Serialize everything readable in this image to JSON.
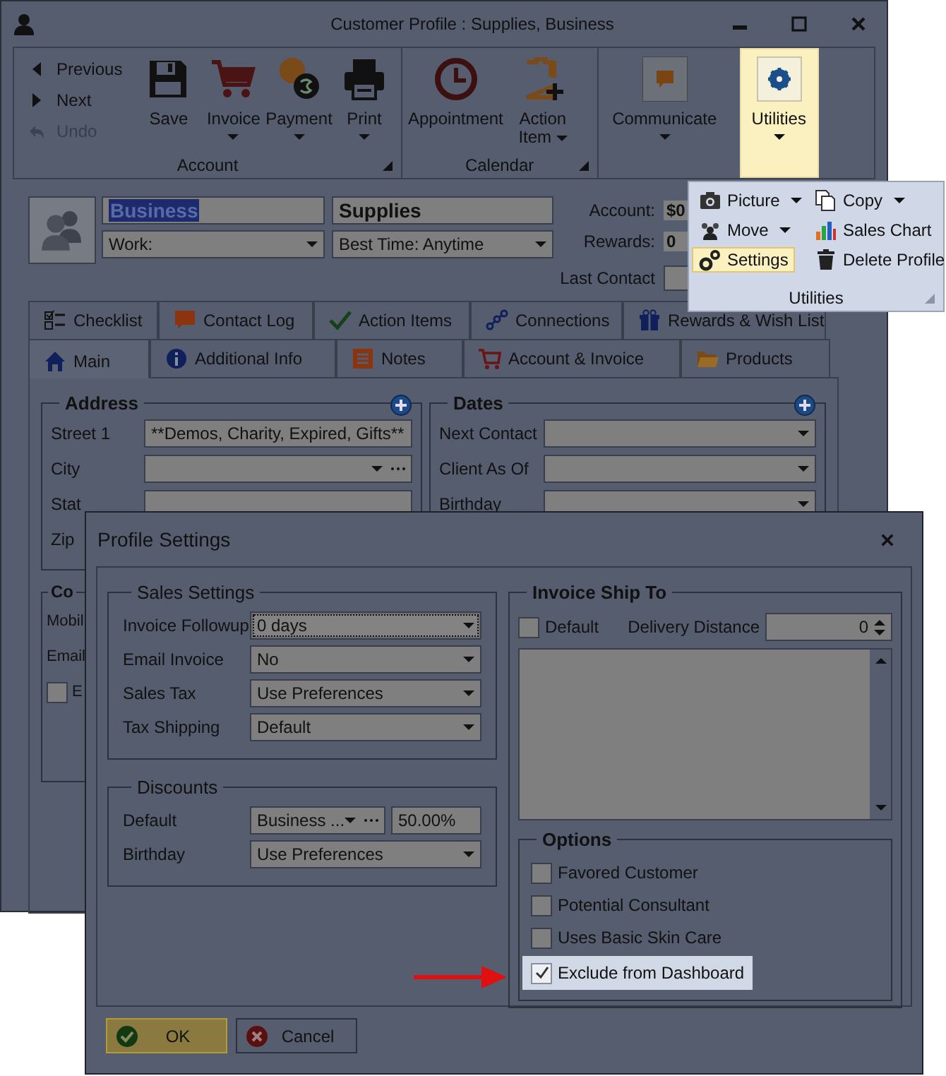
{
  "window": {
    "title": "Customer Profile :  Supplies, Business"
  },
  "ribbon": {
    "nav": [
      {
        "label": "Previous",
        "kind": "prev",
        "disabled": false
      },
      {
        "label": "Next",
        "kind": "next",
        "disabled": false
      },
      {
        "label": "Undo",
        "kind": "undo",
        "disabled": true
      }
    ],
    "groups": [
      {
        "label": "Account",
        "buttons": [
          {
            "label": "Save",
            "kind": "save",
            "dropdown": false,
            "open": false
          },
          {
            "label": "Invoice",
            "kind": "invoice",
            "dropdown": true,
            "open": false
          },
          {
            "label": "Payment",
            "kind": "payment",
            "dropdown": true,
            "open": false
          },
          {
            "label": "Print",
            "kind": "print",
            "dropdown": true,
            "open": false
          }
        ]
      },
      {
        "label": "Calendar",
        "buttons": [
          {
            "label": "Appointment",
            "kind": "appointment",
            "dropdown": false,
            "open": false
          },
          {
            "label": "Action Item",
            "kind": "action",
            "dropdown": true,
            "open": false
          }
        ]
      },
      {
        "buttons": [
          {
            "label": "Communicate",
            "kind": "communicate",
            "dropdown": true,
            "open": false
          },
          {
            "label": "Utilities",
            "kind": "utilities",
            "dropdown": true,
            "open": true
          }
        ]
      }
    ]
  },
  "profile": {
    "first_name": "Business",
    "last_name": "Supplies",
    "phone_type": "Work:",
    "best_time": "Best Time: Anytime",
    "account_label": "Account:",
    "account_value": "$0",
    "rewards_label": "Rewards:",
    "rewards_value": "0",
    "last_contact_label": "Last Contact"
  },
  "utilities_menu": {
    "items": [
      {
        "label": "Picture",
        "kind": "picture",
        "dropdown": true,
        "selected": false
      },
      {
        "label": "Copy",
        "kind": "copy",
        "dropdown": true,
        "selected": false
      },
      {
        "label": "Move",
        "kind": "move",
        "dropdown": true,
        "selected": false
      },
      {
        "label": "Sales Chart",
        "kind": "chart",
        "dropdown": false,
        "selected": false
      },
      {
        "label": "Settings",
        "kind": "settings",
        "dropdown": false,
        "selected": true
      },
      {
        "label": "Delete Profile",
        "kind": "delete",
        "dropdown": false,
        "selected": false
      }
    ],
    "footer": "Utilities"
  },
  "tabs": {
    "row_1": [
      {
        "label": "Checklist",
        "kind": "checklist",
        "selected": false
      },
      {
        "label": "Contact Log",
        "kind": "log",
        "selected": false
      },
      {
        "label": "Action Items",
        "kind": "check",
        "selected": false
      },
      {
        "label": "Connections",
        "kind": "connections",
        "selected": false
      },
      {
        "label": "Rewards & Wish List",
        "kind": "gift",
        "selected": false
      }
    ],
    "row_2": [
      {
        "label": "Main",
        "kind": "home",
        "selected": true
      },
      {
        "label": "Additional Info",
        "kind": "info",
        "selected": false
      },
      {
        "label": "Notes",
        "kind": "notes",
        "selected": false
      },
      {
        "label": "Account & Invoice",
        "kind": "cart",
        "selected": false
      },
      {
        "label": "Products",
        "kind": "folder",
        "selected": false
      }
    ]
  },
  "address": {
    "title": "Address",
    "rows": [
      {
        "label": "Street 1",
        "kind": "text",
        "value": "**Demos, Charity, Expired, Gifts**"
      },
      {
        "label": "City",
        "kind": "combo_more"
      },
      {
        "label": "Stat",
        "kind": "text"
      },
      {
        "label": "Zip",
        "kind": "label"
      }
    ]
  },
  "contact": {
    "title": "Co",
    "rows": [
      {
        "label": "Mobil",
        "kind": "label"
      },
      {
        "label": "Email",
        "kind": "label"
      },
      {
        "label": "E",
        "kind": "check",
        "checked": false
      }
    ]
  },
  "dates": {
    "title": "Dates",
    "rows": [
      {
        "label": "Next Contact"
      },
      {
        "label": "Client As Of"
      },
      {
        "label": "Birthday"
      }
    ]
  },
  "dialog": {
    "title": "Profile Settings",
    "sales_settings": {
      "title": "Sales Settings",
      "rows": [
        {
          "label": "Invoice Followup",
          "value": "0 days",
          "focused": true
        },
        {
          "label": "Email Invoice",
          "value": "No",
          "focused": false
        },
        {
          "label": "Sales Tax",
          "value": "Use Preferences",
          "focused": false
        },
        {
          "label": "Tax Shipping",
          "value": "Default",
          "focused": false
        }
      ]
    },
    "discounts": {
      "title": "Discounts",
      "rows": [
        {
          "label": "Default",
          "kind": "combo_more",
          "value": "Business ...",
          "percent": "50.00%"
        },
        {
          "label": "Birthday",
          "kind": "combo",
          "value": "Use Preferences"
        }
      ]
    },
    "invoice_ship_to": {
      "title": "Invoice Ship To",
      "default": {
        "label": "Default",
        "checked": false
      },
      "distance_label": "Delivery Distance",
      "distance_value": "0"
    },
    "options": {
      "title": "Options",
      "items": [
        {
          "label": "Favored Customer",
          "checked": false,
          "highlighted": false
        },
        {
          "label": "Potential Consultant",
          "checked": false,
          "highlighted": false
        },
        {
          "label": "Uses Basic Skin Care",
          "checked": false,
          "highlighted": false
        },
        {
          "label": "Exclude from Dashboard",
          "checked": true,
          "highlighted": true
        }
      ]
    },
    "buttons": [
      {
        "label": "OK",
        "kind": "ok",
        "default": true
      },
      {
        "label": "Cancel",
        "kind": "cancel",
        "default": false
      }
    ]
  }
}
